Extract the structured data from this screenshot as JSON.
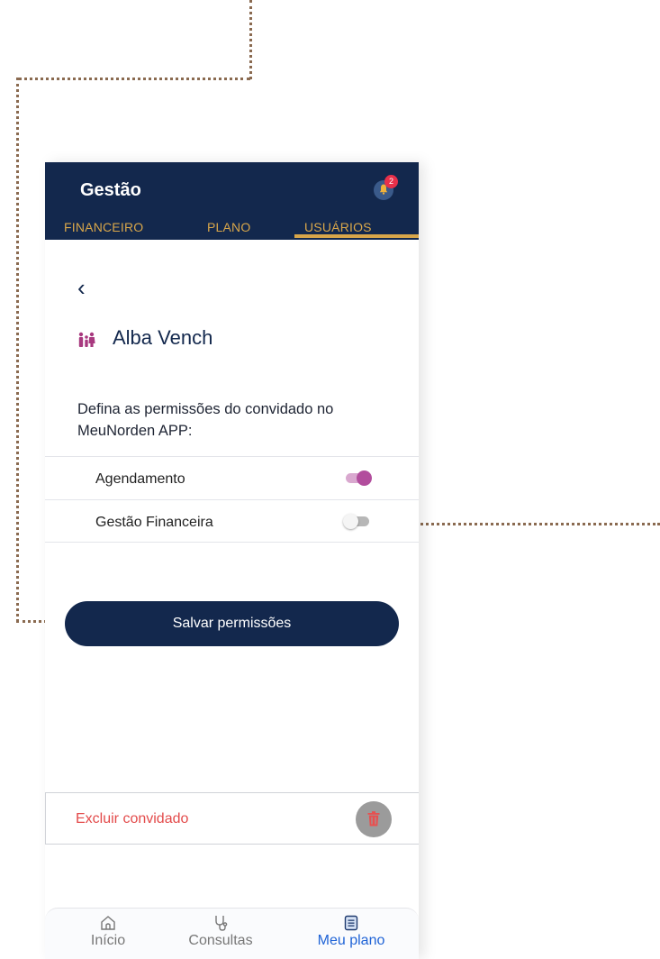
{
  "header": {
    "title": "Gestão",
    "notification_count": "2"
  },
  "tabs": [
    {
      "label": "FINANCEIRO"
    },
    {
      "label": "PLANO"
    },
    {
      "label": "USUÁRIOS",
      "active": true
    }
  ],
  "back_label": "‹",
  "guest": {
    "name": "Alba Vench"
  },
  "description": "Defina as permissões do convidado no MeuNorden APP:",
  "permissions": [
    {
      "label": "Agendamento",
      "enabled": true
    },
    {
      "label": "Gestão Financeira",
      "enabled": false
    }
  ],
  "save_label": "Salvar permissões",
  "delete_label": "Excluir convidado",
  "bottom_nav": [
    {
      "label": "Início",
      "icon": "home-icon"
    },
    {
      "label": "Consultas",
      "icon": "stethoscope-icon"
    },
    {
      "label": "Meu plano",
      "icon": "document-icon",
      "active": true
    }
  ],
  "colors": {
    "header_bg": "#13284d",
    "tab_accent": "#d8a64a",
    "toggle_on": "#b24d9d",
    "delete_text": "#e34b4b",
    "nav_active": "#1f63d6",
    "annotation_dots": "#8a6a50"
  }
}
